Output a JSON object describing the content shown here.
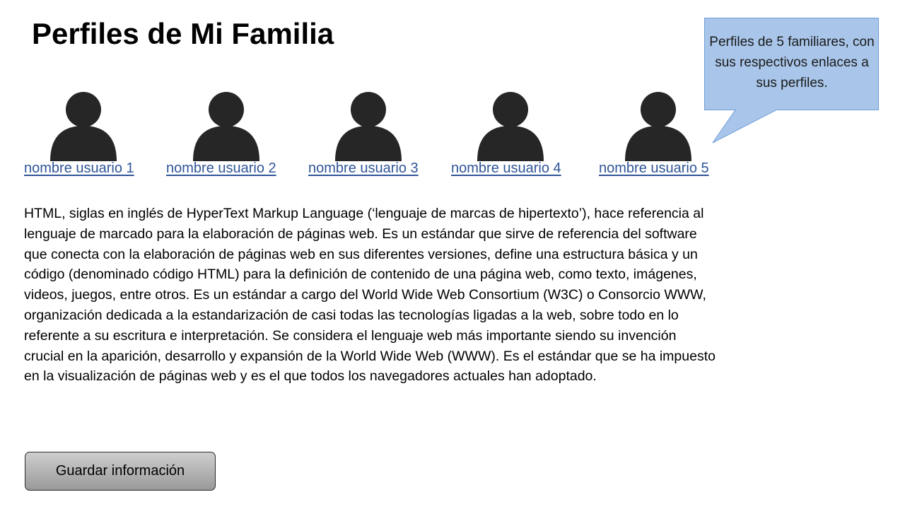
{
  "page": {
    "title": "Perfiles de Mi Familia"
  },
  "profiles": [
    {
      "name": "nombre usuario 1",
      "icon": "user-silhouette-icon"
    },
    {
      "name": "nombre usuario 2",
      "icon": "user-silhouette-icon"
    },
    {
      "name": "nombre usuario 3",
      "icon": "user-silhouette-icon"
    },
    {
      "name": "nombre usuario 4",
      "icon": "user-silhouette-icon"
    },
    {
      "name": "nombre usuario 5",
      "icon": "user-silhouette-icon"
    }
  ],
  "callout": {
    "text": "Perfiles de 5 familiares, con sus respectivos enlaces a sus perfiles."
  },
  "description": {
    "text": "HTML, siglas en inglés de HyperText Markup Language (‘lenguaje de marcas de hipertexto’), hace referencia al lenguaje de marcado para la elaboración de páginas web. Es un estándar que sirve de referencia del software que conecta con la elaboración de páginas web en sus diferentes versiones, define una estructura básica y un código (denominado código HTML) para la definición de contenido de una página web, como texto, imágenes, videos, juegos, entre otros. Es un estándar a cargo del World Wide Web Consortium (W3C) o Consorcio WWW, organización dedicada a la estandarización de casi todas las tecnologías ligadas a la web, sobre todo en lo referente a su escritura e interpretación. Se considera el lenguaje web más importante siendo su invención crucial en la aparición, desarrollo y expansión de la World Wide Web (WWW). Es el estándar que se ha impuesto en la visualización de páginas web y es el que todos los navegadores actuales han adoptado."
  },
  "actions": {
    "save_label": "Guardar información"
  },
  "colors": {
    "link": "#2f5597",
    "avatar": "#262626",
    "callout_fill": "#a9c6ea",
    "callout_border": "#6f9ed8",
    "button_fill": "#b4b4b4"
  }
}
